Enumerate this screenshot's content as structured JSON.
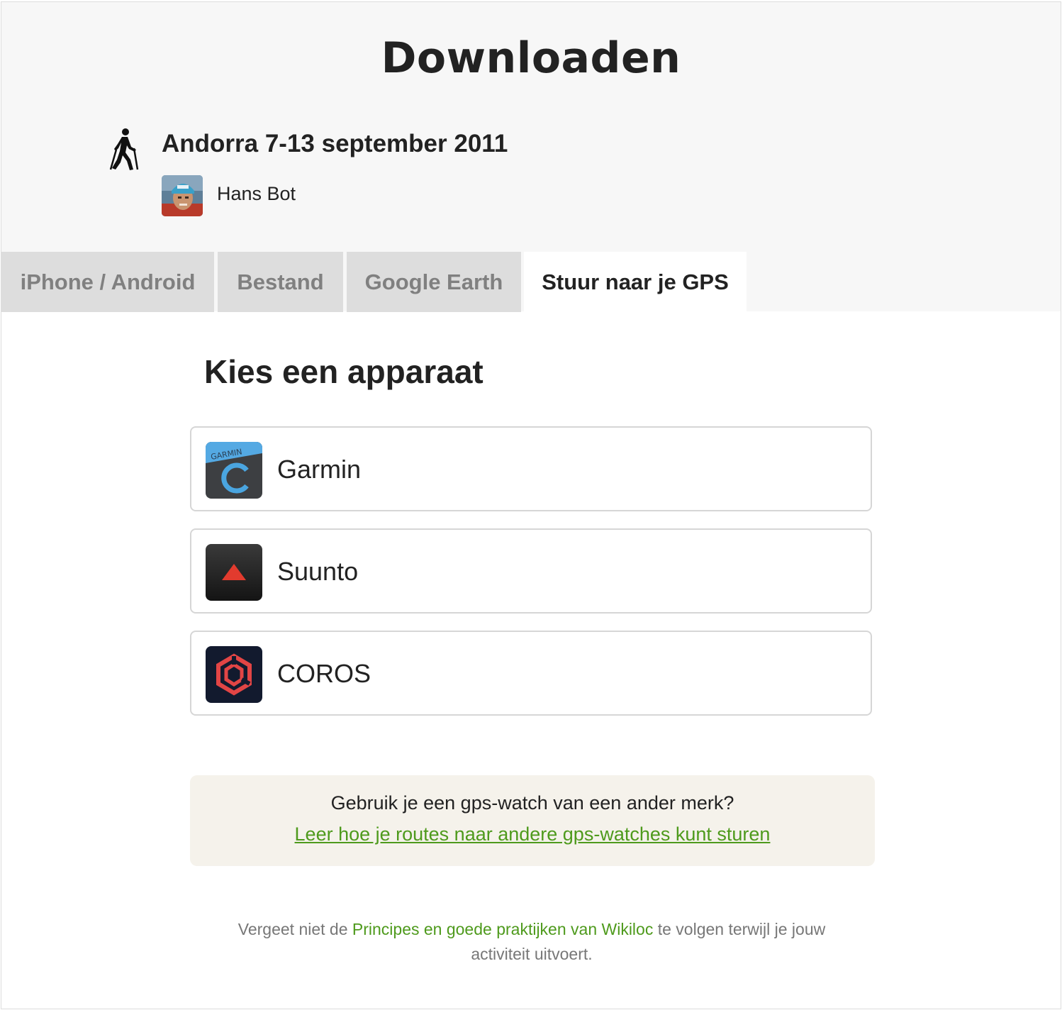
{
  "page": {
    "title": "Downloaden"
  },
  "trail": {
    "activity_icon": "hiker-icon",
    "name": "Andorra 7-13 september 2011",
    "author": "Hans Bot"
  },
  "tabs": [
    {
      "label": "iPhone / Android",
      "active": false
    },
    {
      "label": "Bestand",
      "active": false
    },
    {
      "label": "Google Earth",
      "active": false
    },
    {
      "label": "Stuur naar je GPS",
      "active": true
    }
  ],
  "devices_section": {
    "title": "Kies een apparaat",
    "devices": [
      {
        "label": "Garmin",
        "logo": "garmin-connect-logo",
        "logo_text": "GARMIN"
      },
      {
        "label": "Suunto",
        "logo": "suunto-logo"
      },
      {
        "label": "COROS",
        "logo": "coros-logo"
      }
    ]
  },
  "notice": {
    "question": "Gebruik je een gps-watch van een ander merk?",
    "link": "Leer hoe je routes naar andere gps-watches kunt sturen"
  },
  "footer": {
    "before": "Vergeet niet de ",
    "link": "Principes en goede praktijken van Wikiloc",
    "after": " te volgen terwijl je jouw activiteit uitvoert."
  },
  "colors": {
    "accent_green": "#4e9a1c",
    "header_bg": "#f7f7f7",
    "tab_inactive_bg": "#dddddd",
    "notice_bg": "#f5f2eb"
  }
}
